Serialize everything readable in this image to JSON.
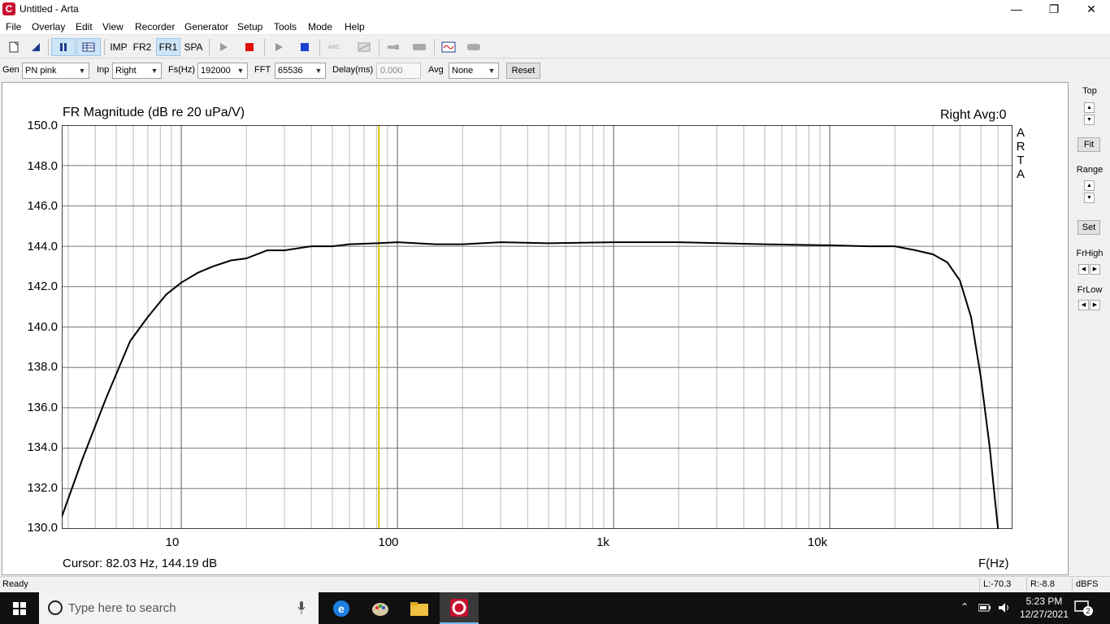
{
  "window": {
    "title": "Untitled - Arta",
    "minimize": "—",
    "maximize": "❐",
    "close": "✕"
  },
  "menu": [
    "File",
    "Overlay",
    "Edit",
    "View",
    "Recorder",
    "Generator",
    "Setup",
    "Tools",
    "Mode",
    "Help"
  ],
  "toolbar": {
    "imp": "IMP",
    "fr2": "FR2",
    "fr1": "FR1",
    "spa": "SPA",
    "abc": "ABC"
  },
  "settings": {
    "gen_label": "Gen",
    "gen_value": "PN pink",
    "inp_label": "Inp",
    "inp_value": "Right",
    "fs_label": "Fs(Hz)",
    "fs_value": "192000",
    "fft_label": "FFT",
    "fft_value": "65536",
    "delay_label": "Delay(ms)",
    "delay_value": "0.000",
    "avg_label": "Avg",
    "avg_value": "None",
    "reset_label": "Reset"
  },
  "plot": {
    "channel_info": "Right  Avg:0",
    "cursor_readout": "Cursor: 82.03 Hz, 144.19 dB",
    "arta_letters": [
      "A",
      "R",
      "T",
      "A"
    ]
  },
  "chart_data": {
    "type": "line",
    "title": "FR Magnitude (dB re 20 uPa/V)",
    "xlabel": "F(Hz)",
    "ylabel": "",
    "x_scale": "log",
    "xlim": [
      2.8,
      70000
    ],
    "ylim": [
      130,
      150
    ],
    "x_tick_labels": [
      "10",
      "100",
      "1k",
      "10k"
    ],
    "x_tick_values": [
      10,
      100,
      1000,
      10000
    ],
    "y_tick_labels": [
      "150.0",
      "148.0",
      "146.0",
      "144.0",
      "142.0",
      "140.0",
      "138.0",
      "136.0",
      "134.0",
      "132.0",
      "130.0"
    ],
    "y_tick_values": [
      150,
      148,
      146,
      144,
      142,
      140,
      138,
      136,
      134,
      132,
      130
    ],
    "grid": true,
    "cursor_hz": 82.03,
    "cursor_color": "#d4c400",
    "line_color": "#000000",
    "series": [
      {
        "x": [
          2.8,
          3.5,
          4.5,
          5.8,
          7.0,
          8.5,
          10,
          12,
          14,
          17,
          20,
          25,
          30,
          40,
          50,
          60,
          80,
          100,
          150,
          200,
          300,
          500,
          1000,
          2000,
          5000,
          10000,
          15000,
          20000,
          25000,
          30000,
          35000,
          40000,
          45000,
          50000,
          55000,
          58000,
          60000
        ],
        "y": [
          130.6,
          133.5,
          136.5,
          139.3,
          140.5,
          141.6,
          142.2,
          142.7,
          143.0,
          143.3,
          143.4,
          143.8,
          143.8,
          144.0,
          144.0,
          144.1,
          144.15,
          144.2,
          144.1,
          144.1,
          144.2,
          144.15,
          144.2,
          144.2,
          144.1,
          144.05,
          144.0,
          144.0,
          143.8,
          143.6,
          143.2,
          142.3,
          140.5,
          137.5,
          134.0,
          131.5,
          130.0
        ]
      }
    ]
  },
  "right_panel": {
    "top_label": "Top",
    "fit_label": "Fit",
    "range_label": "Range",
    "set_label": "Set",
    "frhigh_label": "FrHigh",
    "frlow_label": "FrLow"
  },
  "status": {
    "text": "Ready",
    "left_level": "L:-70.3",
    "right_level": "R:-8.8",
    "unit": "dBFS"
  },
  "taskbar": {
    "search_placeholder": "Type here to search",
    "time": "5:23 PM",
    "date": "12/27/2021",
    "notification_count": "2"
  }
}
